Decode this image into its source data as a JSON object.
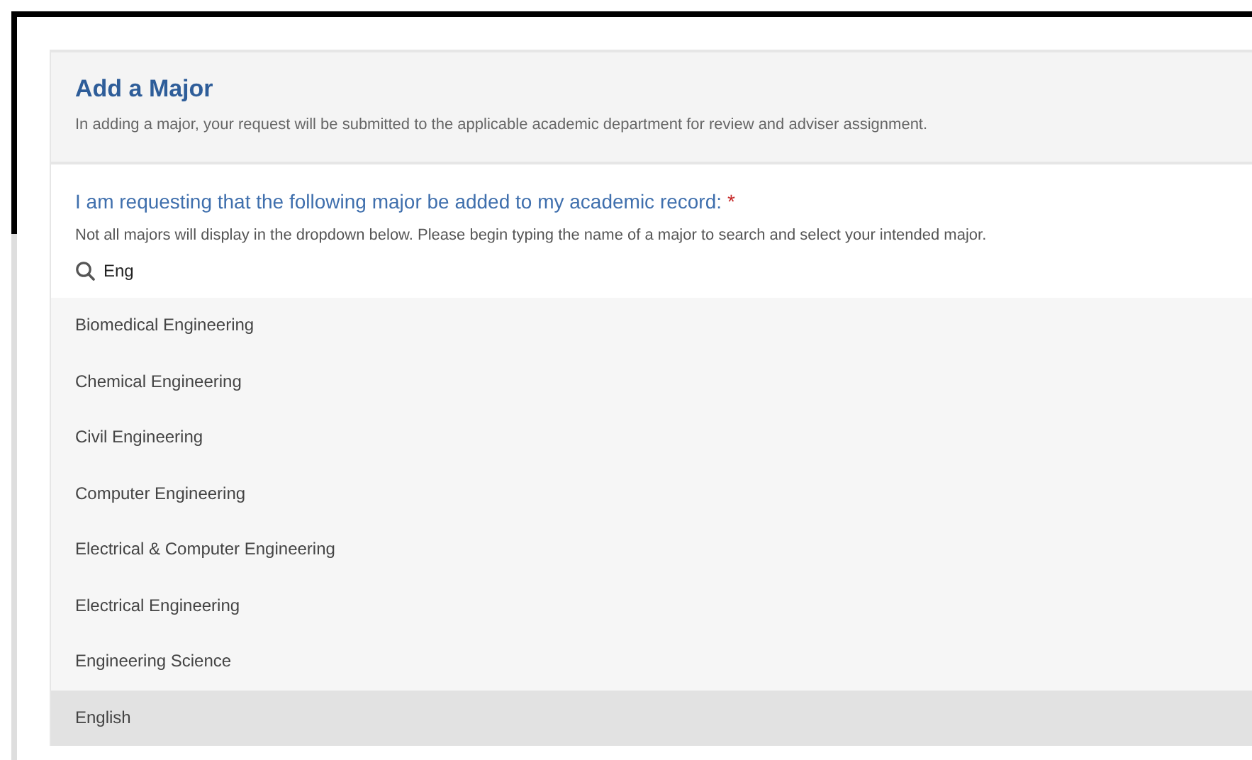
{
  "panel": {
    "title": "Add a Major",
    "description": "In adding a major, your request will be submitted to the applicable academic department for review and adviser assignment."
  },
  "question": {
    "label": "I am requesting that the following major be added to my academic record:",
    "required_mark": "*",
    "hint": "Not all majors will display in the dropdown below. Please begin typing the name of a major to search and select your intended major."
  },
  "search": {
    "value": "Eng"
  },
  "options": [
    {
      "label": "Biomedical Engineering",
      "selected": false
    },
    {
      "label": "Chemical Engineering",
      "selected": false
    },
    {
      "label": "Civil Engineering",
      "selected": false
    },
    {
      "label": "Computer Engineering",
      "selected": false
    },
    {
      "label": "Electrical & Computer Engineering",
      "selected": false
    },
    {
      "label": "Electrical Engineering",
      "selected": false
    },
    {
      "label": "Engineering Science",
      "selected": false
    },
    {
      "label": "English",
      "selected": true
    }
  ]
}
